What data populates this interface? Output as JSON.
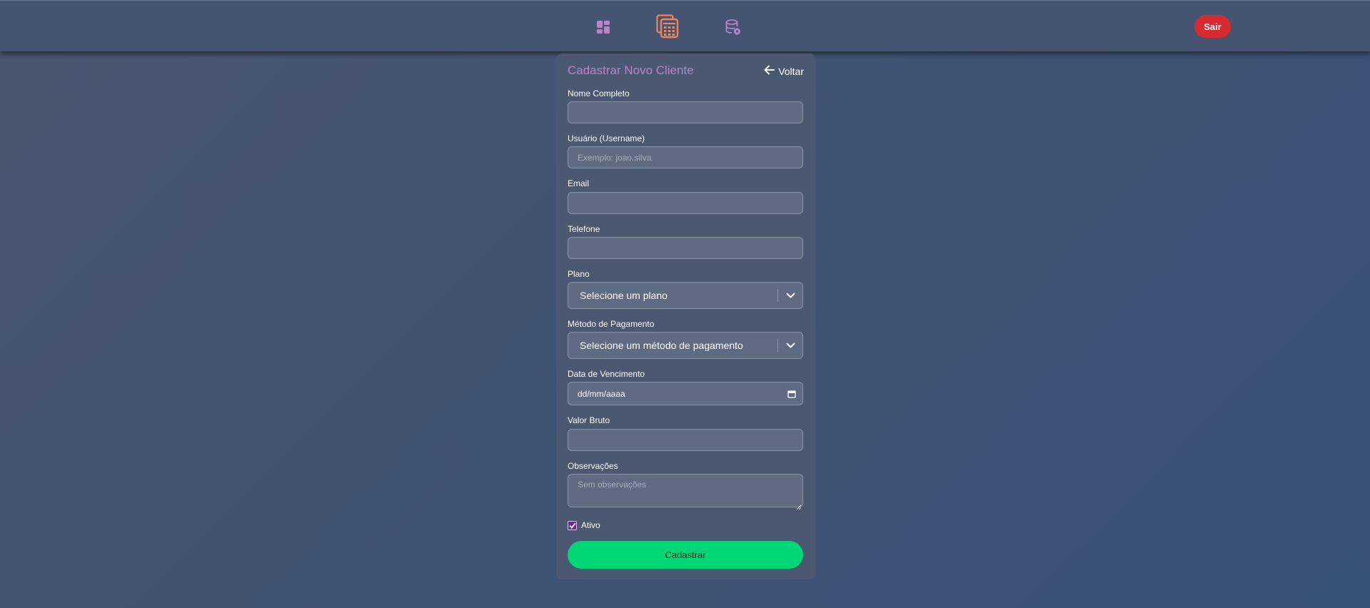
{
  "nav": {
    "icons": [
      "dashboard-icon",
      "calculator-icon",
      "database-settings-icon"
    ],
    "logout_label": "Sair",
    "active_color": "#f0845c",
    "inactive_color": "#b984c8",
    "logout_color": "#d62b31"
  },
  "form": {
    "title": "Cadastrar Novo Cliente",
    "back_label": "Voltar",
    "fields": {
      "name": {
        "label": "Nome Completo",
        "value": "",
        "placeholder": ""
      },
      "username": {
        "label": "Usuário (Username)",
        "value": "",
        "placeholder": "Exemplo: joao.silva"
      },
      "email": {
        "label": "Email",
        "value": "",
        "placeholder": ""
      },
      "phone": {
        "label": "Telefone",
        "value": "",
        "placeholder": ""
      },
      "plan": {
        "label": "Plano",
        "selected": "Selecione um plano"
      },
      "payment": {
        "label": "Método de Pagamento",
        "selected": "Selecione um método de pagamento"
      },
      "due_date": {
        "label": "Data de Vencimento",
        "value": "dd/mm/aaaa"
      },
      "gross_value": {
        "label": "Valor Bruto",
        "value": "",
        "placeholder": ""
      },
      "notes": {
        "label": "Observações",
        "value": "",
        "placeholder": "Sem observações"
      }
    },
    "active": {
      "label": "Ativo",
      "checked": true
    },
    "submit_label": "Cadastrar",
    "submit_color": "#00d675",
    "title_color": "#b984c8"
  }
}
